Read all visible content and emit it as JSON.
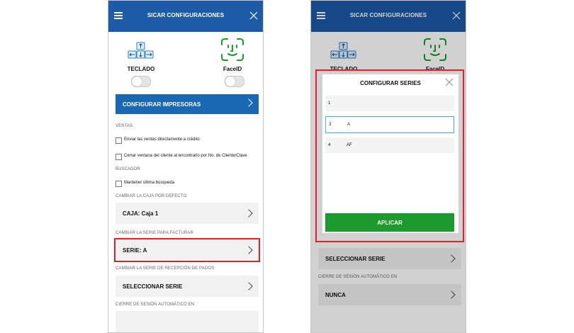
{
  "header": {
    "title": "SICAR CONFIGURACIONES"
  },
  "options": {
    "teclado_label": "TECLADO",
    "faceid_label": "FaceID"
  },
  "config_impresoras_label": "CONFIGURAR IMPRESORAS",
  "ventas": {
    "section_label": "VENTAS",
    "check1": "Enviar las ventas directamente a crédito",
    "check2": "Cerrar ventana del cliente al encontrarlo por No. de Cliente/Clave"
  },
  "buscador": {
    "section_label": "BUSCADOR",
    "check1": "Mantener última búsqueda"
  },
  "caja": {
    "section_label": "CAMBIAR LA CAJA POR DEFECTO",
    "value": "CAJA: Caja 1"
  },
  "serie_factura": {
    "section_label": "CAMBIAR LA SERIE PARA FACTURAR",
    "value": "SERIE: A"
  },
  "serie_pagos": {
    "section_label": "CAMBIAR LA SERIE DE RECEPCIÓN DE PAGOS",
    "value": "SELECCIONAR SERIE"
  },
  "cierre": {
    "section_label": "CIERRE DE SESIÓN AUTOMÁTICO EN",
    "value": "NUNCA"
  },
  "modal": {
    "title": "CONFIGURAR SERIES",
    "rows": [
      {
        "num": "1",
        "serie": ""
      },
      {
        "num": "3",
        "serie": "A"
      },
      {
        "num": "4",
        "serie": "AF"
      }
    ],
    "apply_label": "APLICAR"
  },
  "colors": {
    "header": "#1d5aa8",
    "primary_button": "#1968b3",
    "apply_button": "#1c9a2c",
    "highlight": "#e0202a",
    "faceid": "#1c9a2c"
  }
}
